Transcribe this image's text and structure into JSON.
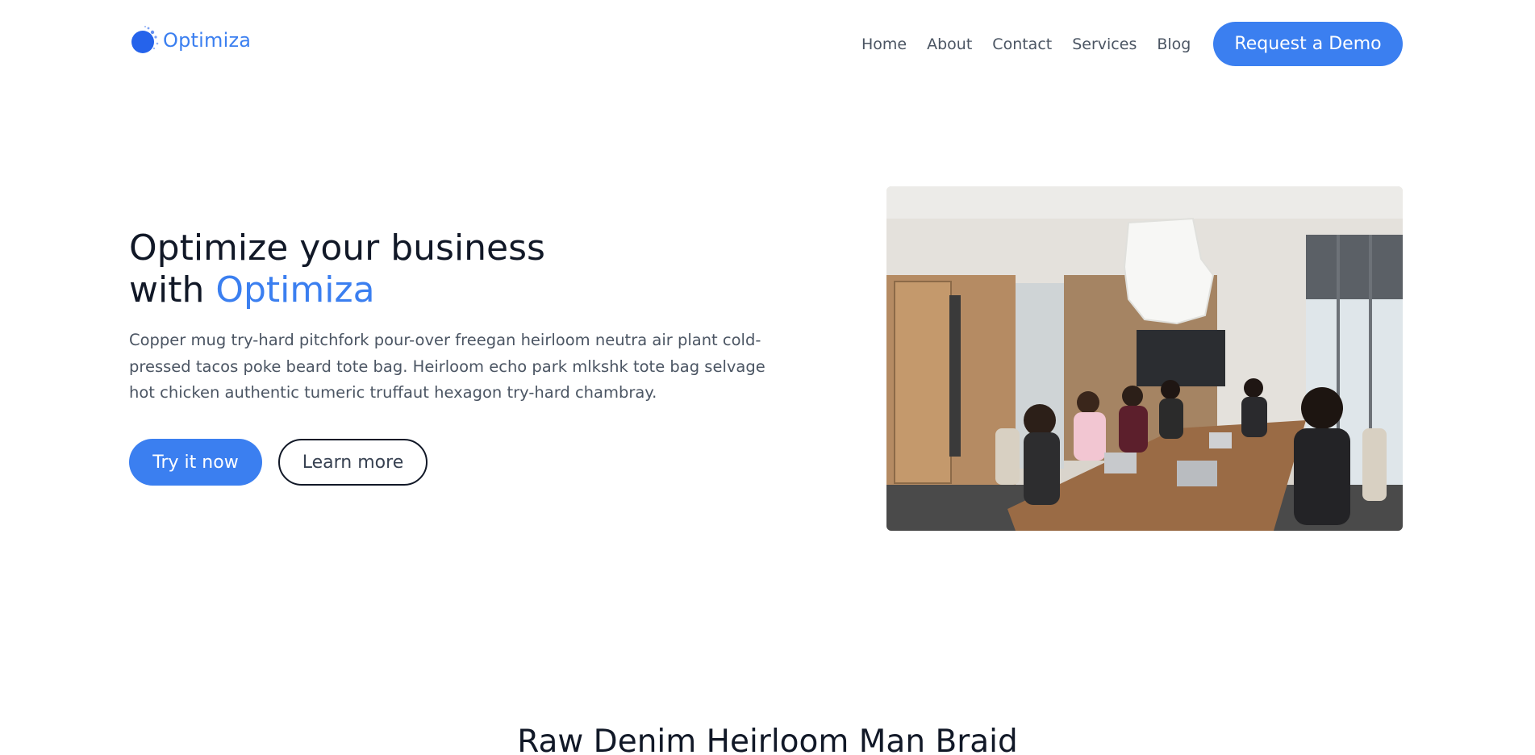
{
  "brand": {
    "name": "Optimiza",
    "color": "#3b7ff0",
    "logo_icon": "paint-splat-icon"
  },
  "nav": {
    "links": [
      "Home",
      "About",
      "Contact",
      "Services",
      "Blog"
    ],
    "cta_label": "Request a Demo"
  },
  "hero": {
    "title_line1": "Optimize your business",
    "title_prefix": "with ",
    "title_accent": "Optimiza",
    "paragraph": "Copper mug try-hard pitchfork pour-over freegan heirloom neutra air plant cold-pressed tacos poke beard tote bag. Heirloom echo park mlkshk tote bag selvage hot chicken authentic tumeric truffaut hexagon try-hard chambray.",
    "primary_button": "Try it now",
    "secondary_button": "Learn more",
    "image_alt": "office-meeting-photo"
  },
  "section": {
    "title": "Raw Denim Heirloom Man Braid"
  }
}
